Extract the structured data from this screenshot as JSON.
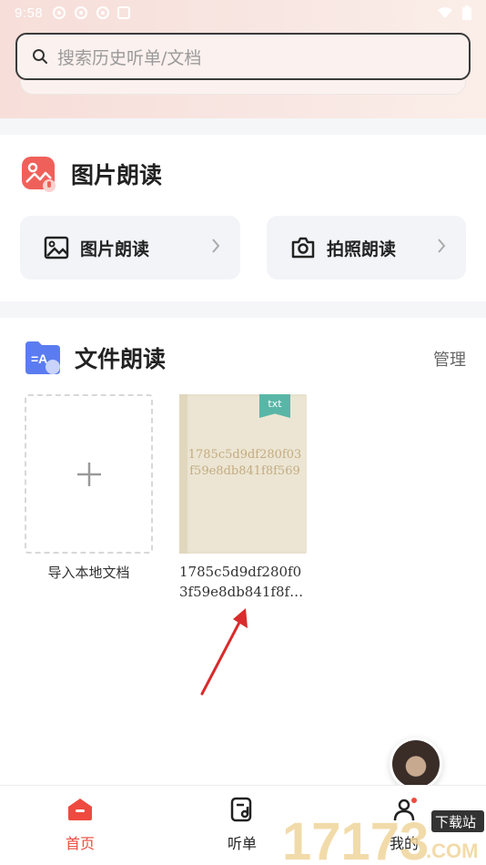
{
  "status_bar": {
    "time": "9:58"
  },
  "search": {
    "placeholder": "搜索历史听单/文档"
  },
  "image_reading": {
    "title": "图片朗读",
    "buttons": [
      {
        "label": "图片朗读",
        "icon": "image-icon"
      },
      {
        "label": "拍照朗读",
        "icon": "camera-icon"
      }
    ]
  },
  "file_reading": {
    "title": "文件朗读",
    "manage_label": "管理",
    "import_label": "导入本地文档",
    "document": {
      "tag": "txt",
      "cover_title": "1785c5d9df280f03f59e8db841f8f569",
      "name": "1785c5d9df280f03f59e8db841f8f…"
    }
  },
  "bottom_nav": {
    "items": [
      {
        "label": "首页",
        "icon": "home-icon",
        "active": true
      },
      {
        "label": "听单",
        "icon": "playlist-icon",
        "active": false
      },
      {
        "label": "我的",
        "icon": "profile-icon",
        "active": false
      }
    ]
  },
  "watermark": {
    "text": "17173",
    "badge": "下载站",
    "domain": ".COM"
  },
  "colors": {
    "accent": "#ef4a3f",
    "tag": "#59b6a7",
    "book_cover": "#ece5d3"
  }
}
